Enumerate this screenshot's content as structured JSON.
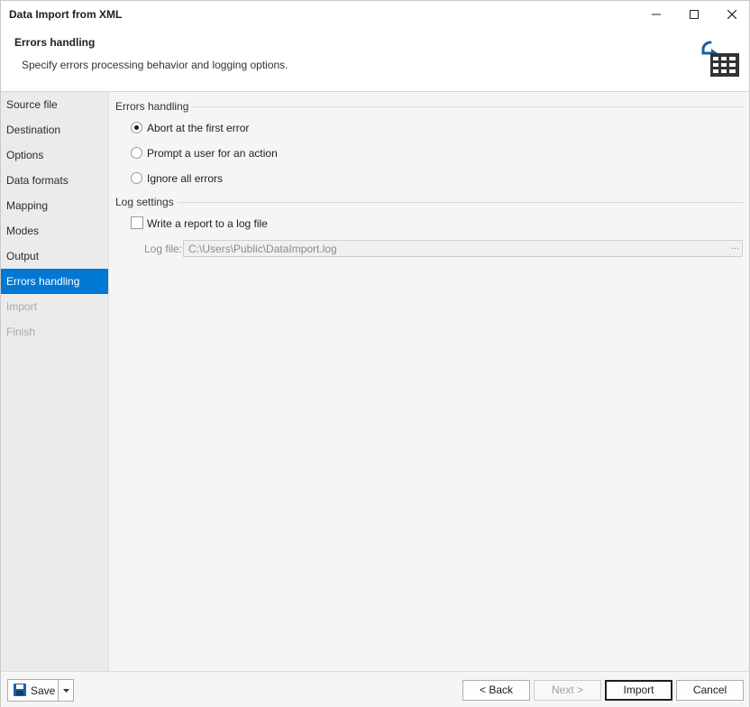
{
  "window": {
    "title": "Data Import from XML"
  },
  "header": {
    "title": "Errors handling",
    "subtitle": "Specify errors processing behavior and logging options."
  },
  "sidebar": {
    "items": [
      {
        "label": "Source file",
        "state": "normal"
      },
      {
        "label": "Destination",
        "state": "normal"
      },
      {
        "label": "Options",
        "state": "normal"
      },
      {
        "label": "Data formats",
        "state": "normal"
      },
      {
        "label": "Mapping",
        "state": "normal"
      },
      {
        "label": "Modes",
        "state": "normal"
      },
      {
        "label": "Output",
        "state": "normal"
      },
      {
        "label": "Errors handling",
        "state": "active"
      },
      {
        "label": "Import",
        "state": "disabled"
      },
      {
        "label": "Finish",
        "state": "disabled"
      }
    ]
  },
  "errors_handling": {
    "group_label": "Errors handling",
    "options": [
      {
        "label": "Abort at the first error",
        "selected": true
      },
      {
        "label": "Prompt a user for an action",
        "selected": false
      },
      {
        "label": "Ignore all errors",
        "selected": false
      }
    ]
  },
  "log_settings": {
    "group_label": "Log settings",
    "write_report_label": "Write a report to a log file",
    "write_report_checked": false,
    "log_file_label": "Log file:",
    "log_file_value": "C:\\Users\\Public\\DataImport.log",
    "browse_label": "..."
  },
  "footer": {
    "save_label": "Save",
    "back_label": "< Back",
    "next_label": "Next >",
    "import_label": "Import",
    "cancel_label": "Cancel"
  },
  "colors": {
    "accent": "#0078d4",
    "icon_blue": "#1a5fa8",
    "icon_dark": "#333333"
  }
}
